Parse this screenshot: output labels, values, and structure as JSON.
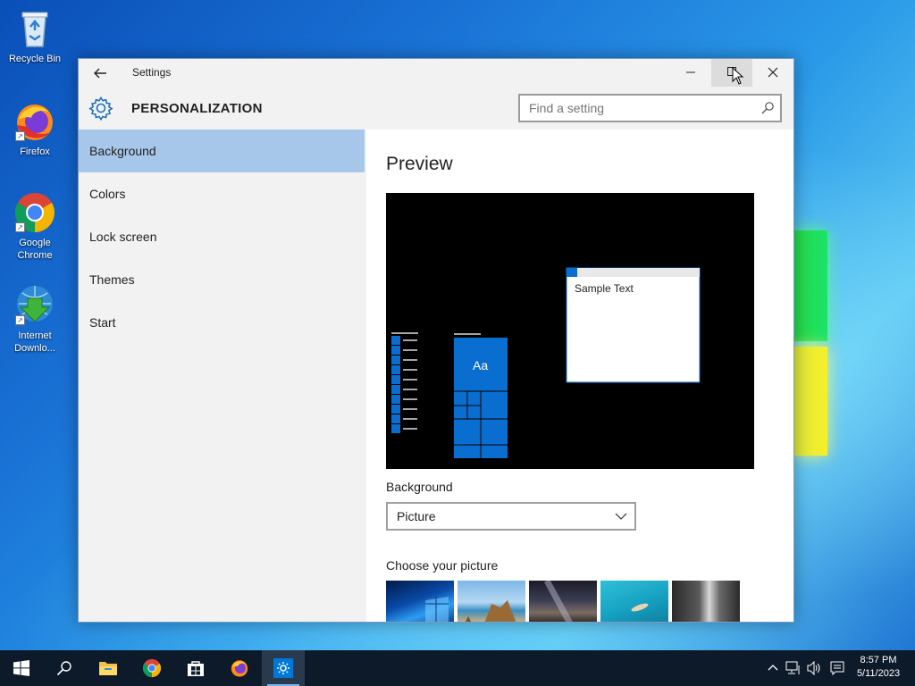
{
  "desktop": {
    "icons": [
      {
        "label": "Recycle Bin",
        "icon": "recycle-bin-icon"
      },
      {
        "label": "Firefox",
        "icon": "firefox-icon"
      },
      {
        "label": "Google Chrome",
        "icon": "chrome-icon"
      },
      {
        "label": "Internet Downlo...",
        "icon": "idm-icon"
      }
    ]
  },
  "window": {
    "title": "Settings",
    "section_title": "PERSONALIZATION",
    "search_placeholder": "Find a setting",
    "nav": [
      {
        "label": "Background",
        "selected": true
      },
      {
        "label": "Colors",
        "selected": false
      },
      {
        "label": "Lock screen",
        "selected": false
      },
      {
        "label": "Themes",
        "selected": false
      },
      {
        "label": "Start",
        "selected": false
      }
    ],
    "content": {
      "preview_title": "Preview",
      "preview_window_text": "Sample Text",
      "preview_tile_text": "Aa",
      "background_label": "Background",
      "background_value": "Picture",
      "choose_label": "Choose your picture",
      "pictures": [
        "windows-blue-wallpaper",
        "beach-rocks-wallpaper",
        "night-sky-wallpaper",
        "underwater-swimmer-wallpaper",
        "waterfall-wallpaper"
      ]
    },
    "accent_color": "#0078d7",
    "selected_nav_color": "#a6c7ea"
  },
  "taskbar": {
    "buttons": [
      "start-button",
      "search-button",
      "file-explorer-button",
      "chrome-button",
      "store-button",
      "firefox-button",
      "settings-button"
    ],
    "tray_icons": [
      "show-hidden-icons-icon",
      "network-icon",
      "volume-icon",
      "action-center-icon"
    ],
    "time": "8:57 PM",
    "date": "5/11/2023"
  }
}
